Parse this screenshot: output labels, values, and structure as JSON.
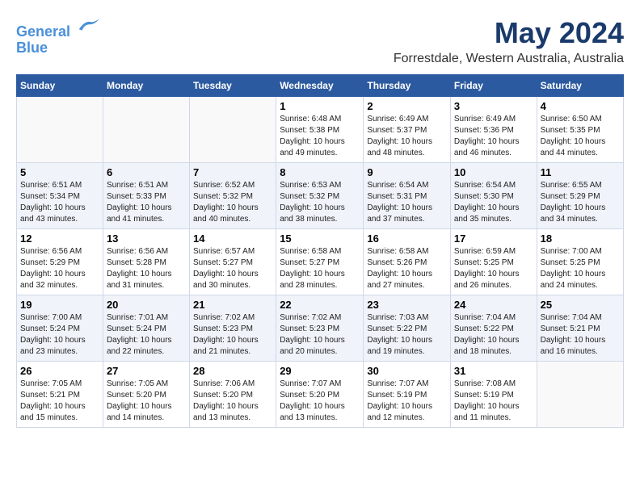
{
  "header": {
    "logo_line1": "General",
    "logo_line2": "Blue",
    "title": "May 2024",
    "subtitle": "Forrestdale, Western Australia, Australia"
  },
  "days_of_week": [
    "Sunday",
    "Monday",
    "Tuesday",
    "Wednesday",
    "Thursday",
    "Friday",
    "Saturday"
  ],
  "weeks": [
    [
      {
        "day": "",
        "content": ""
      },
      {
        "day": "",
        "content": ""
      },
      {
        "day": "",
        "content": ""
      },
      {
        "day": "1",
        "content": "Sunrise: 6:48 AM\nSunset: 5:38 PM\nDaylight: 10 hours\nand 49 minutes."
      },
      {
        "day": "2",
        "content": "Sunrise: 6:49 AM\nSunset: 5:37 PM\nDaylight: 10 hours\nand 48 minutes."
      },
      {
        "day": "3",
        "content": "Sunrise: 6:49 AM\nSunset: 5:36 PM\nDaylight: 10 hours\nand 46 minutes."
      },
      {
        "day": "4",
        "content": "Sunrise: 6:50 AM\nSunset: 5:35 PM\nDaylight: 10 hours\nand 44 minutes."
      }
    ],
    [
      {
        "day": "5",
        "content": "Sunrise: 6:51 AM\nSunset: 5:34 PM\nDaylight: 10 hours\nand 43 minutes."
      },
      {
        "day": "6",
        "content": "Sunrise: 6:51 AM\nSunset: 5:33 PM\nDaylight: 10 hours\nand 41 minutes."
      },
      {
        "day": "7",
        "content": "Sunrise: 6:52 AM\nSunset: 5:32 PM\nDaylight: 10 hours\nand 40 minutes."
      },
      {
        "day": "8",
        "content": "Sunrise: 6:53 AM\nSunset: 5:32 PM\nDaylight: 10 hours\nand 38 minutes."
      },
      {
        "day": "9",
        "content": "Sunrise: 6:54 AM\nSunset: 5:31 PM\nDaylight: 10 hours\nand 37 minutes."
      },
      {
        "day": "10",
        "content": "Sunrise: 6:54 AM\nSunset: 5:30 PM\nDaylight: 10 hours\nand 35 minutes."
      },
      {
        "day": "11",
        "content": "Sunrise: 6:55 AM\nSunset: 5:29 PM\nDaylight: 10 hours\nand 34 minutes."
      }
    ],
    [
      {
        "day": "12",
        "content": "Sunrise: 6:56 AM\nSunset: 5:29 PM\nDaylight: 10 hours\nand 32 minutes."
      },
      {
        "day": "13",
        "content": "Sunrise: 6:56 AM\nSunset: 5:28 PM\nDaylight: 10 hours\nand 31 minutes."
      },
      {
        "day": "14",
        "content": "Sunrise: 6:57 AM\nSunset: 5:27 PM\nDaylight: 10 hours\nand 30 minutes."
      },
      {
        "day": "15",
        "content": "Sunrise: 6:58 AM\nSunset: 5:27 PM\nDaylight: 10 hours\nand 28 minutes."
      },
      {
        "day": "16",
        "content": "Sunrise: 6:58 AM\nSunset: 5:26 PM\nDaylight: 10 hours\nand 27 minutes."
      },
      {
        "day": "17",
        "content": "Sunrise: 6:59 AM\nSunset: 5:25 PM\nDaylight: 10 hours\nand 26 minutes."
      },
      {
        "day": "18",
        "content": "Sunrise: 7:00 AM\nSunset: 5:25 PM\nDaylight: 10 hours\nand 24 minutes."
      }
    ],
    [
      {
        "day": "19",
        "content": "Sunrise: 7:00 AM\nSunset: 5:24 PM\nDaylight: 10 hours\nand 23 minutes."
      },
      {
        "day": "20",
        "content": "Sunrise: 7:01 AM\nSunset: 5:24 PM\nDaylight: 10 hours\nand 22 minutes."
      },
      {
        "day": "21",
        "content": "Sunrise: 7:02 AM\nSunset: 5:23 PM\nDaylight: 10 hours\nand 21 minutes."
      },
      {
        "day": "22",
        "content": "Sunrise: 7:02 AM\nSunset: 5:23 PM\nDaylight: 10 hours\nand 20 minutes."
      },
      {
        "day": "23",
        "content": "Sunrise: 7:03 AM\nSunset: 5:22 PM\nDaylight: 10 hours\nand 19 minutes."
      },
      {
        "day": "24",
        "content": "Sunrise: 7:04 AM\nSunset: 5:22 PM\nDaylight: 10 hours\nand 18 minutes."
      },
      {
        "day": "25",
        "content": "Sunrise: 7:04 AM\nSunset: 5:21 PM\nDaylight: 10 hours\nand 16 minutes."
      }
    ],
    [
      {
        "day": "26",
        "content": "Sunrise: 7:05 AM\nSunset: 5:21 PM\nDaylight: 10 hours\nand 15 minutes."
      },
      {
        "day": "27",
        "content": "Sunrise: 7:05 AM\nSunset: 5:20 PM\nDaylight: 10 hours\nand 14 minutes."
      },
      {
        "day": "28",
        "content": "Sunrise: 7:06 AM\nSunset: 5:20 PM\nDaylight: 10 hours\nand 13 minutes."
      },
      {
        "day": "29",
        "content": "Sunrise: 7:07 AM\nSunset: 5:20 PM\nDaylight: 10 hours\nand 13 minutes."
      },
      {
        "day": "30",
        "content": "Sunrise: 7:07 AM\nSunset: 5:19 PM\nDaylight: 10 hours\nand 12 minutes."
      },
      {
        "day": "31",
        "content": "Sunrise: 7:08 AM\nSunset: 5:19 PM\nDaylight: 10 hours\nand 11 minutes."
      },
      {
        "day": "",
        "content": ""
      }
    ]
  ]
}
